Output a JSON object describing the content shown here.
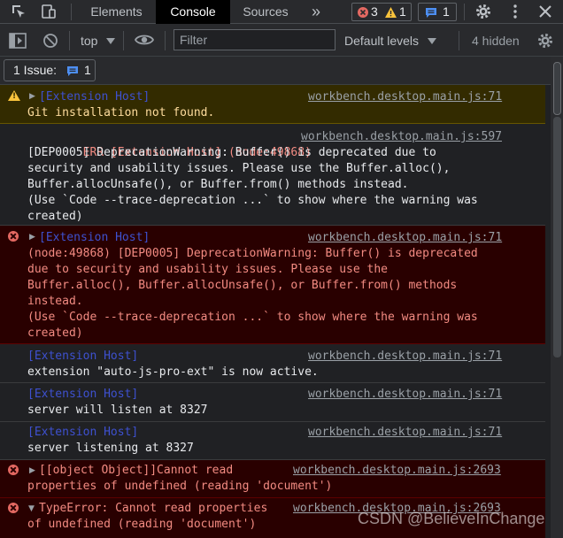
{
  "tabs": {
    "elements": "Elements",
    "console": "Console",
    "sources": "Sources",
    "more": "»"
  },
  "badges": {
    "errors": "3",
    "warnings": "1",
    "messages": "1"
  },
  "toolbar": {
    "context": "top",
    "filter_placeholder": "Filter",
    "levels": "Default levels",
    "hidden": "4 hidden"
  },
  "issues": {
    "label": "1 Issue:",
    "count": "1"
  },
  "colors": {
    "warning_bg": "#332b00",
    "error_bg": "#290000",
    "error_text": "#f28b82",
    "tag_blue": "#3e51d0",
    "active_tab": "#000000"
  },
  "log": [
    {
      "level": "warning",
      "tag": "[Extension Host]",
      "source": "workbench.desktop.main.js:71",
      "lines": [
        "Git installation not found."
      ]
    },
    {
      "level": "plain",
      "prefix": "  ERR [Extension Host] (node:49868)",
      "source": "workbench.desktop.main.js:597",
      "lines": [
        "[DEP0005] DeprecationWarning: Buffer() is deprecated due to",
        "security and usability issues. Please use the Buffer.alloc(),",
        "Buffer.allocUnsafe(), or Buffer.from() methods instead.",
        "(Use `Code --trace-deprecation ...` to show where the warning was",
        "created)"
      ]
    },
    {
      "level": "error",
      "tag": "[Extension Host]",
      "source": "workbench.desktop.main.js:71",
      "lines": [
        "(node:49868) [DEP0005] DeprecationWarning: Buffer() is deprecated",
        "due to security and usability issues. Please use the",
        "Buffer.alloc(), Buffer.allocUnsafe(), or Buffer.from() methods",
        "instead.",
        "(Use `Code --trace-deprecation ...` to show where the warning was",
        "created)"
      ]
    },
    {
      "level": "plain",
      "tag": "[Extension Host]",
      "source": "workbench.desktop.main.js:71",
      "lines": [
        "extension \"auto-js-pro-ext\" is now active."
      ]
    },
    {
      "level": "plain",
      "tag": "[Extension Host]",
      "source": "workbench.desktop.main.js:71",
      "lines": [
        "server will listen at 8327"
      ]
    },
    {
      "level": "plain",
      "tag": "[Extension Host]",
      "source": "workbench.desktop.main.js:71",
      "lines": [
        "server listening at 8327"
      ]
    },
    {
      "level": "error",
      "first": "[[object Object]]Cannot read",
      "source": "workbench.desktop.main.js:2693",
      "lines": [
        "properties of undefined (reading 'document')"
      ]
    },
    {
      "level": "error",
      "first": "TypeError: Cannot read properties",
      "source": "workbench.desktop.main.js:2693",
      "lines": [
        "of undefined (reading 'document')"
      ]
    }
  ],
  "watermark": "CSDN @BelieveInChange"
}
